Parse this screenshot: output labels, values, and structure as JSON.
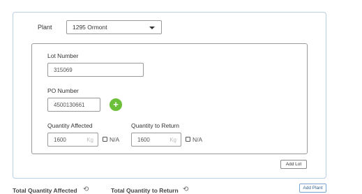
{
  "plant": {
    "label": "Plant",
    "selected": "1295 Ormont"
  },
  "lot": {
    "lot_number_label": "Lot Number",
    "lot_number_value": "315069",
    "po_number_label": "PO Number",
    "po_number_value": "4500130661",
    "add_po_glyph": "+",
    "quantity_affected_label": "Quantity Affected",
    "quantity_affected_value": "1600",
    "quantity_affected_unit": "Kg",
    "quantity_affected_na": "N/A",
    "quantity_to_return_label": "Quantity to Return",
    "quantity_to_return_value": "1600",
    "quantity_to_return_unit": "Kg",
    "quantity_to_return_na": "N/A"
  },
  "buttons": {
    "add_lot": "Add Lot",
    "add_plant": "Add Plant"
  },
  "totals": {
    "total_affected_label": "Total Quantity Affected",
    "total_return_label": "Total Quantity to Return",
    "history_glyph": "⟲"
  },
  "colors": {
    "accent_green": "#6cbf3a",
    "card_border": "#b9cfe6"
  }
}
